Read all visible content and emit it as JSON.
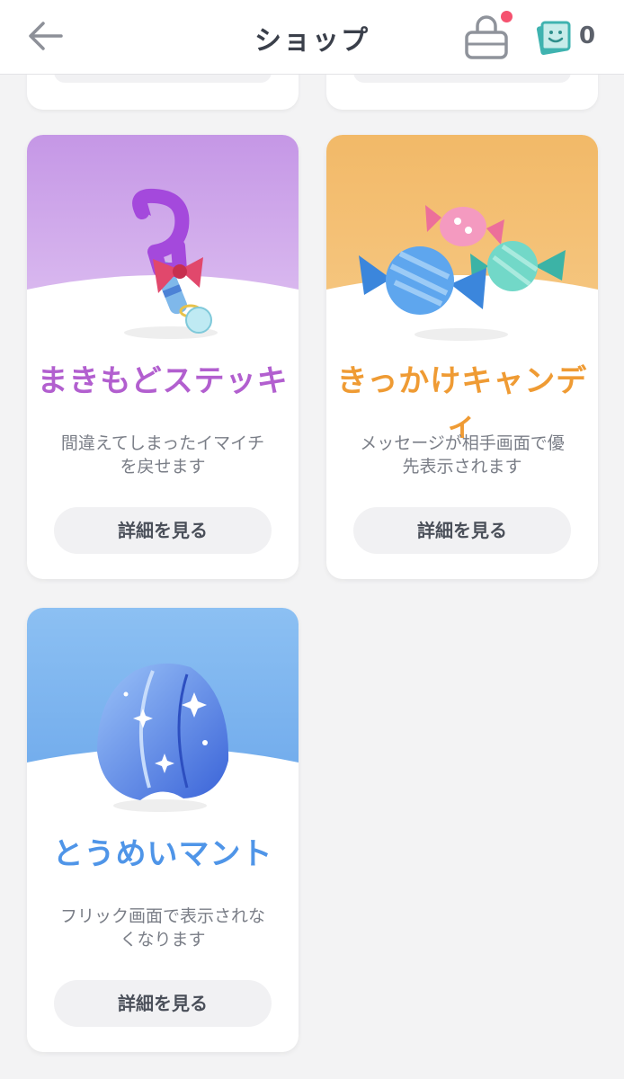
{
  "header": {
    "title": "ショップ",
    "ticket_count": "0"
  },
  "items": [
    {
      "name": "まきもどステッキ",
      "description": "間違えてしまったイマイチを戻せます",
      "button_label": "詳細を見る",
      "name_color": "#b25fcf",
      "bg_top": "#c597e6"
    },
    {
      "name": "きっかけキャンディ",
      "description": "メッセージが相手画面で優先表示されます",
      "button_label": "詳細を見る",
      "name_color": "#ef9b34",
      "bg_top": "#f2b968"
    },
    {
      "name": "とうめいマント",
      "description": "フリック画面で表示されなくなります",
      "button_label": "詳細を見る",
      "name_color": "#4f95e8",
      "bg_top": "#8cc0f3"
    }
  ]
}
